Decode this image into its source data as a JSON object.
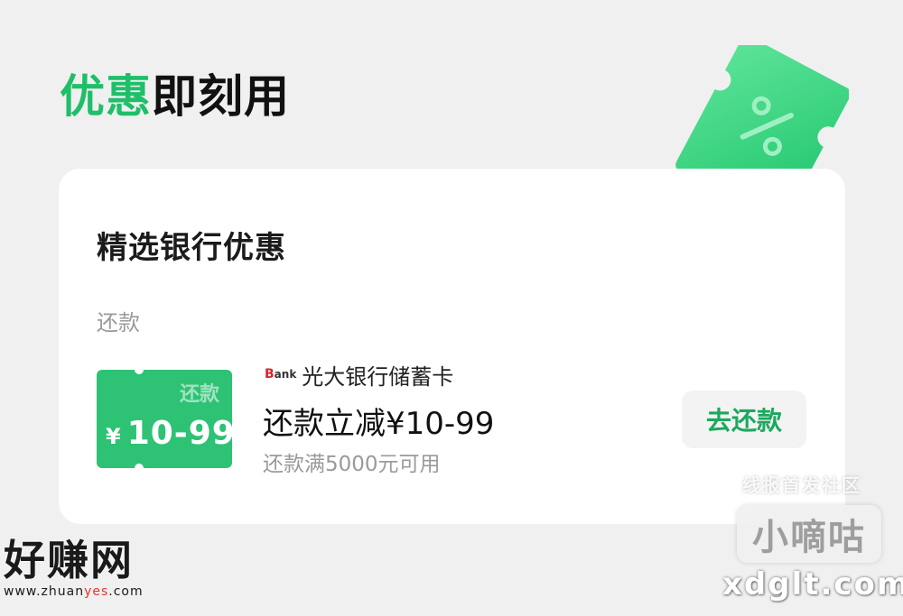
{
  "header": {
    "title_accent": "优惠",
    "title_rest": "即刻用"
  },
  "card": {
    "title": "精选银行优惠",
    "section_label": "还款",
    "offer": {
      "bank_logo_text": "ank",
      "bank_logo_letter": "B",
      "bank_name": "光大银行储蓄卡",
      "title": "还款立减¥10-99",
      "condition": "还款满5000元可用",
      "coupon_tag": "还款",
      "coupon_currency": "¥",
      "coupon_amount": "10-99",
      "action_label": "去还款"
    }
  },
  "watermarks": {
    "left_title": "好赚网",
    "left_url_prefix": "www.zhuan",
    "left_url_highlight": "yes",
    "left_url_suffix": ".com",
    "right_caption": "线报首发社区",
    "right_box": "小嘀咕",
    "right_url": "xdglt.com"
  },
  "colors": {
    "accent_green": "#1fbf69",
    "coupon_green": "#2ec275",
    "button_text": "#1da85e"
  },
  "icons": {
    "decoration": "discount-ticket-icon",
    "bank": "bank-logo-icon"
  }
}
